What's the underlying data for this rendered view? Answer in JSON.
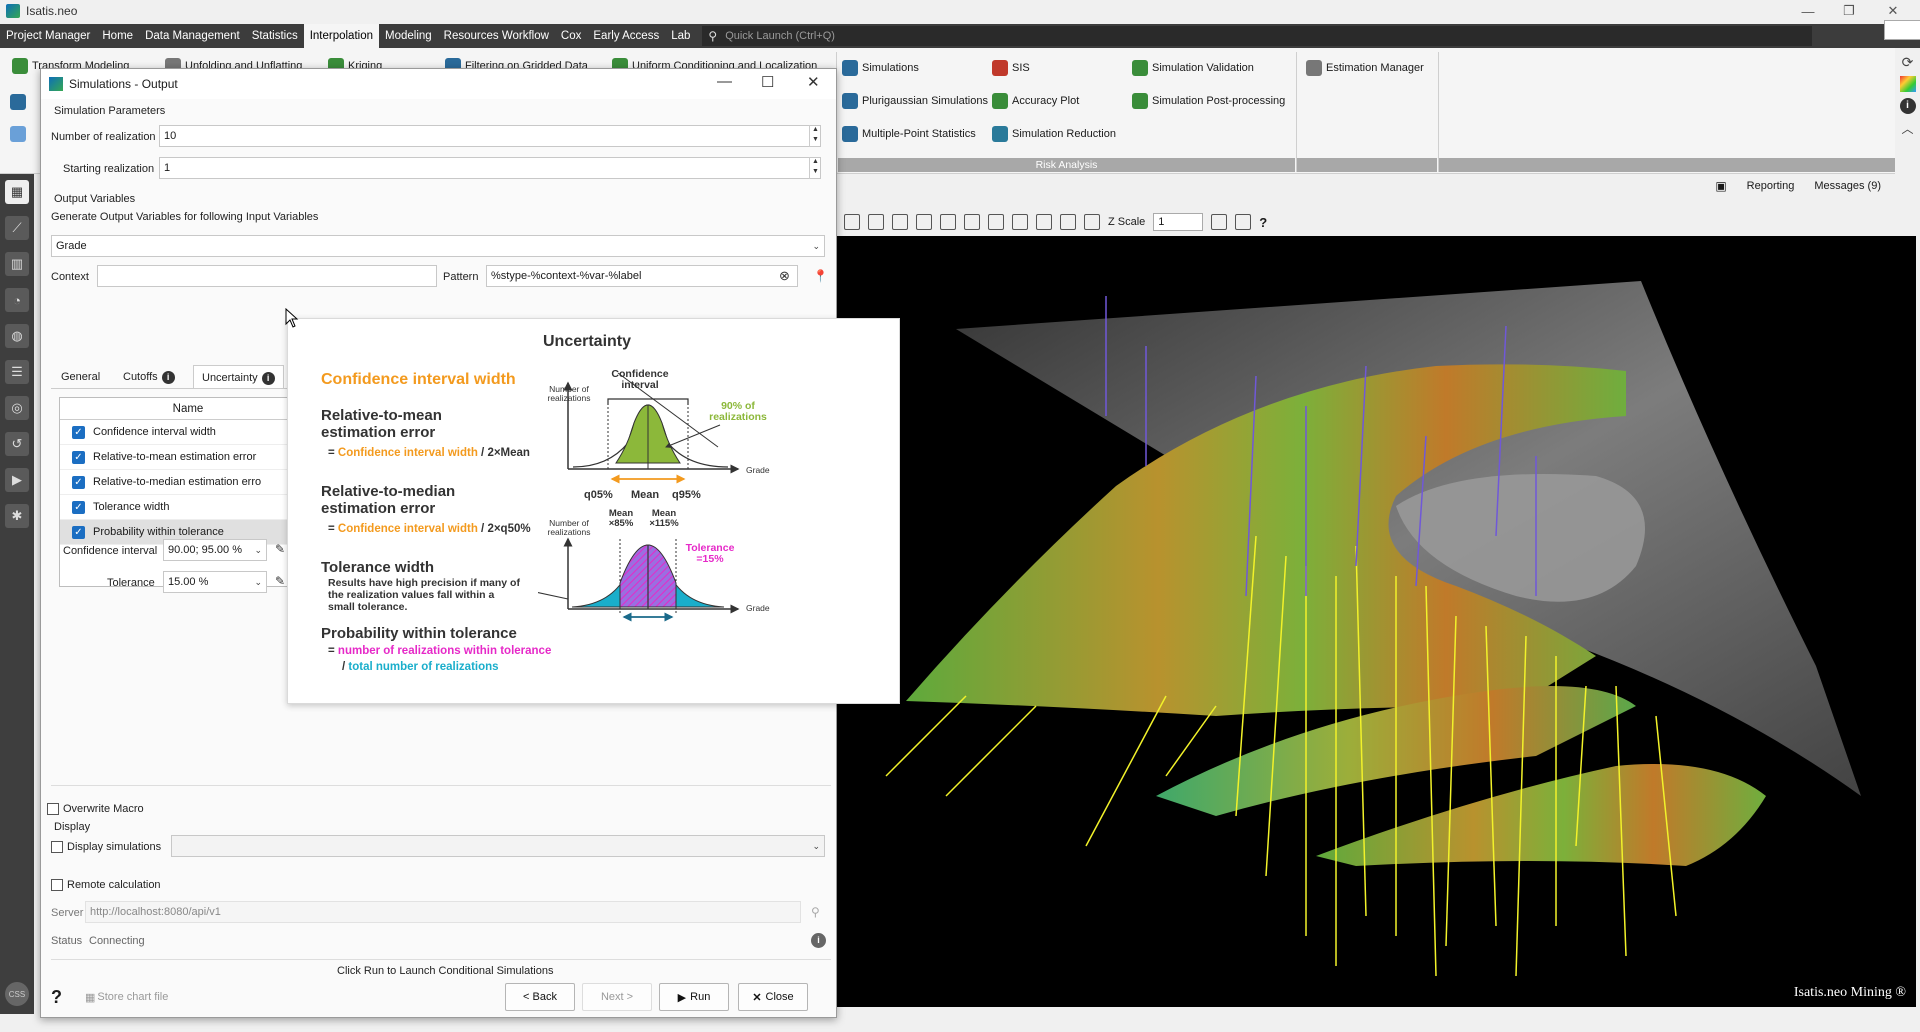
{
  "window": {
    "title": "Isatis.neo"
  },
  "menu": {
    "items": [
      "Project Manager",
      "Home",
      "Data Management",
      "Statistics",
      "Interpolation",
      "Modeling",
      "Resources Workflow",
      "Cox",
      "Early Access",
      "Lab"
    ],
    "active_index": 4,
    "quick_launch_placeholder": "Quick Launch (Ctrl+Q)"
  },
  "ribbon": {
    "partial_items": [
      "Transform Modeling",
      "Unfolding and Unflatting",
      "Kriging",
      "Filtering on Gridded Data",
      "Uniform Conditioning and Localization"
    ],
    "simulation_items": [
      "Simulations",
      "Plurigaussian Simulations",
      "Multiple-Point Statistics"
    ],
    "sis_items": [
      "SIS",
      "Accuracy Plot",
      "Simulation Reduction"
    ],
    "validation_items": [
      "Simulation Validation",
      "Simulation Post-processing"
    ],
    "estimation_items": [
      "Estimation Manager"
    ],
    "group_label": "Risk Analysis"
  },
  "viewer": {
    "reporting": "Reporting",
    "messages": "Messages (9)",
    "zscale_label": "Z Scale",
    "zscale_value": "1",
    "help": "?",
    "watermark": "Isatis.neo Mining ®"
  },
  "dialog": {
    "title": "Simulations - Output",
    "sim_params_header": "Simulation Parameters",
    "num_realization_label": "Number of realization",
    "num_realization_value": "10",
    "start_realization_label": "Starting realization",
    "start_realization_value": "1",
    "output_vars_header": "Output Variables",
    "generate_label": "Generate Output Variables for following Input Variables",
    "input_variable": "Grade",
    "context_label": "Context",
    "context_value": "",
    "pattern_label": "Pattern",
    "pattern_value": "%stype-%context-%var-%label",
    "tabs": [
      "General",
      "Cutoffs",
      "Uncertainty"
    ],
    "active_tab": 2,
    "table_header": "Name",
    "table_rows": [
      {
        "name": "Confidence interval width",
        "checked": true
      },
      {
        "name": "Relative-to-mean estimation error",
        "checked": true
      },
      {
        "name": "Relative-to-median estimation erro",
        "checked": true
      },
      {
        "name": "Tolerance width",
        "checked": true
      },
      {
        "name": "Probability within tolerance",
        "checked": true
      }
    ],
    "confidence_label": "Confidence interval",
    "confidence_value": "90.00; 95.00 %",
    "tolerance_label": "Tolerance",
    "tolerance_value": "15.00 %",
    "overwrite_macro": "Overwrite Macro",
    "display_header": "Display",
    "display_simulations": "Display simulations",
    "remote_calculation": "Remote calculation",
    "server_label": "Server",
    "server_value": "http://localhost:8080/api/v1",
    "status_label": "Status",
    "status_value": "Connecting",
    "footer_hint": "Click Run to Launch Conditional Simulations",
    "store_chart": "Store chart file",
    "back": "< Back",
    "next": "Next >",
    "run": "Run",
    "close": "Close"
  },
  "tooltip": {
    "title": "Uncertainty",
    "ciw": "Confidence interval width",
    "rme_title": "Relative-to-mean estimation error",
    "rme_formula_pre": "= ",
    "rme_formula_hl": "Confidence interval width",
    "rme_formula_post": " / 2×Mean",
    "rmd_title": "Relative-to-median estimation error",
    "rmd_formula_hl": "Confidence interval width",
    "rmd_formula_post": " / 2×q50%",
    "tw_title": "Tolerance width",
    "tw_desc": "Results have high precision if many of the realization values fall within a small tolerance.",
    "pwt_title": "Probability within tolerance",
    "pwt_num": "number of realizations within tolerance",
    "pwt_den": "total number of realizations",
    "chart1": {
      "ylabel": "Number of realizations",
      "xlabel": "Grade",
      "ci_label": "Confidence interval",
      "pct_label": "90% of realizations",
      "ticks": [
        "q05%",
        "Mean",
        "q95%"
      ]
    },
    "chart2": {
      "ylabel": "Number of realizations",
      "xlabel": "Grade",
      "low_label": "Mean ×85%",
      "high_label": "Mean ×115%",
      "tol_label": "Tolerance =15%"
    },
    "colors": {
      "orange": "#f39a1e",
      "green": "#8cb83a",
      "magenta": "#e629c8",
      "cyan": "#1aaecb",
      "purple": "#9b6ee0"
    }
  }
}
